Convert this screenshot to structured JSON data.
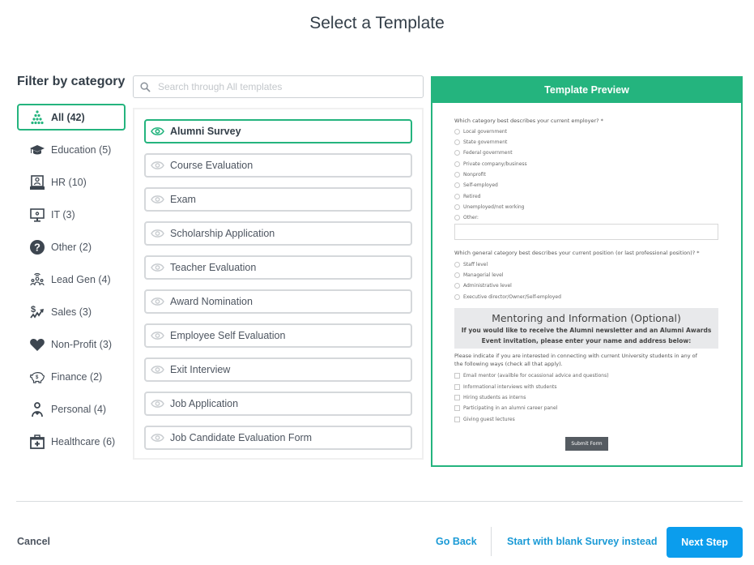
{
  "title": "Select a Template",
  "sidebar": {
    "heading": "Filter by category",
    "items": [
      {
        "label": "All (42)",
        "icon": "pyramid-dots-icon",
        "active": true
      },
      {
        "label": "Education (5)",
        "icon": "graduation-cap-icon"
      },
      {
        "label": "HR (10)",
        "icon": "id-badge-icon"
      },
      {
        "label": "IT (3)",
        "icon": "monitor-gear-icon"
      },
      {
        "label": "Other (2)",
        "icon": "question-circle-icon"
      },
      {
        "label": "Lead Gen (4)",
        "icon": "people-broadcast-icon"
      },
      {
        "label": "Sales (3)",
        "icon": "dollar-trend-icon"
      },
      {
        "label": "Non-Profit (3)",
        "icon": "heart-icon"
      },
      {
        "label": "Finance (2)",
        "icon": "piggy-bank-icon"
      },
      {
        "label": "Personal (4)",
        "icon": "person-heart-icon"
      },
      {
        "label": "Healthcare (6)",
        "icon": "medical-kit-icon"
      }
    ]
  },
  "search": {
    "placeholder": "Search through All templates",
    "value": ""
  },
  "templates": [
    {
      "label": "Alumni Survey",
      "active": true
    },
    {
      "label": "Course Evaluation"
    },
    {
      "label": "Exam"
    },
    {
      "label": "Scholarship Application"
    },
    {
      "label": "Teacher Evaluation"
    },
    {
      "label": "Award Nomination"
    },
    {
      "label": "Employee Self Evaluation"
    },
    {
      "label": "Exit Interview"
    },
    {
      "label": "Job Application"
    },
    {
      "label": "Job Candidate Evaluation Form"
    }
  ],
  "preview": {
    "header": "Template Preview",
    "q1": "Which category best describes your current employer? *",
    "q1_options": [
      "Local government",
      "State government",
      "Federal government",
      "Private company/business",
      "Nonprofit",
      "Self-employed",
      "Retired",
      "Unemployed/not working",
      "Other:"
    ],
    "q2": "Which general category best describes your current position (or last professional position)? *",
    "q2_options": [
      "Staff level",
      "Managerial level",
      "Administrative level",
      "Executive director/Owner/Self-employed"
    ],
    "section_title": "Mentoring and Information (Optional)",
    "section_sub_1": "If you would like to receive the Alumni newsletter and an Alumni Awards",
    "section_sub_2": "Event invitation, please enter your name and address below:",
    "q3_1": "Please indicate if you are interested in connecting with current University students in any of",
    "q3_2": "the following ways (check all that apply).",
    "q3_options": [
      "Email mentor (availble for ocassional advice and questions)",
      "Informational interviews with students",
      "Hiring students as interns",
      "Participating in an alumni career panel",
      "Giving guest lectures"
    ],
    "submit": "Submit Form"
  },
  "footer": {
    "cancel": "Cancel",
    "go_back": "Go Back",
    "blank": "Start with blank Survey instead",
    "next": "Next Step"
  },
  "colors": {
    "accent_green": "#24b47e",
    "primary_blue": "#0b9ded",
    "link_blue": "#1a9ad6"
  }
}
